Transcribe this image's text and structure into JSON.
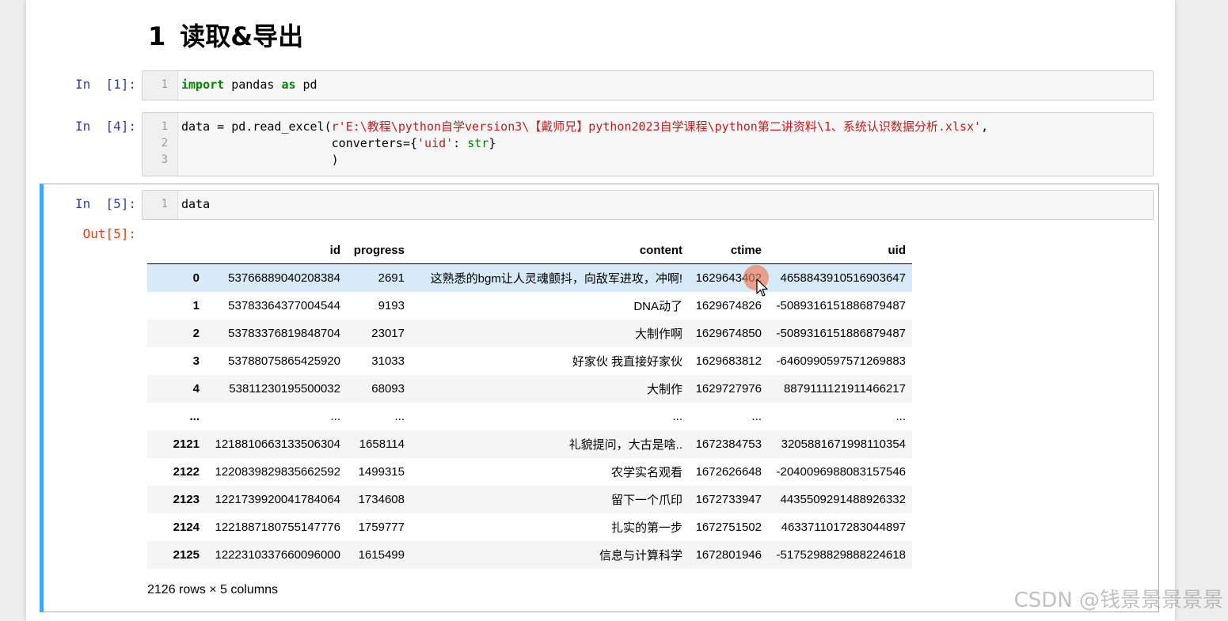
{
  "heading": {
    "number": "1",
    "title": "读取&导出"
  },
  "cells": [
    {
      "prompt": "In  [1]:",
      "lines": [
        {
          "no": "1",
          "kw1": "import",
          "mid": " pandas ",
          "kw2": "as",
          "end": " pd"
        }
      ]
    },
    {
      "prompt": "In  [4]:",
      "lines": [
        {
          "no": "1",
          "pre": "data = pd.read_excel(",
          "str": "r'E:\\教程\\python自学version3\\【戴师兄】python2023自学课程\\python第二讲资料\\1、系统认识数据分析.xlsx'",
          "post": ","
        },
        {
          "no": "2",
          "pre": "                     converters={",
          "str": "'uid'",
          "mid": ": ",
          "builtin": "str",
          "post": "}"
        },
        {
          "no": "3",
          "text": "                     )"
        }
      ]
    },
    {
      "prompt": "In  [5]:",
      "out_prompt": "Out[5]:",
      "lines": [
        {
          "no": "1",
          "text": "data"
        }
      ]
    }
  ],
  "dataframe": {
    "columns": [
      "id",
      "progress",
      "content",
      "ctime",
      "uid"
    ],
    "rows": [
      {
        "index": "0",
        "id": "53766889040208384",
        "progress": "2691",
        "content": "这熟悉的bgm让人灵魂颤抖，向敌军进攻，冲啊!",
        "ctime": "1629643402",
        "uid": "4658843910516903647"
      },
      {
        "index": "1",
        "id": "53783364377004544",
        "progress": "9193",
        "content": "DNA动了",
        "ctime": "1629674826",
        "uid": "-5089316151886879487"
      },
      {
        "index": "2",
        "id": "53783376819848704",
        "progress": "23017",
        "content": "大制作啊",
        "ctime": "1629674850",
        "uid": "-5089316151886879487"
      },
      {
        "index": "3",
        "id": "53788075865425920",
        "progress": "31033",
        "content": "好家伙 我直接好家伙",
        "ctime": "1629683812",
        "uid": "-6460990597571269883"
      },
      {
        "index": "4",
        "id": "53811230195500032",
        "progress": "68093",
        "content": "大制作",
        "ctime": "1629727976",
        "uid": "8879111121911466217"
      },
      {
        "index": "...",
        "id": "...",
        "progress": "...",
        "content": "...",
        "ctime": "...",
        "uid": "..."
      },
      {
        "index": "2121",
        "id": "1218810663133506304",
        "progress": "1658114",
        "content": "礼貌提问，大古是啥..",
        "ctime": "1672384753",
        "uid": "3205881671998110354"
      },
      {
        "index": "2122",
        "id": "1220839829835662592",
        "progress": "1499315",
        "content": "农学实名观看",
        "ctime": "1672626648",
        "uid": "-2040096988083157546"
      },
      {
        "index": "2123",
        "id": "1221739920041784064",
        "progress": "1734608",
        "content": "留下一个爪印",
        "ctime": "1672733947",
        "uid": "4435509291488926332"
      },
      {
        "index": "2124",
        "id": "1221887180755147776",
        "progress": "1759777",
        "content": "扎实的第一步",
        "ctime": "1672751502",
        "uid": "4633711017283044897"
      },
      {
        "index": "2125",
        "id": "1222310337660096000",
        "progress": "1615499",
        "content": "信息与计算科学",
        "ctime": "1672801946",
        "uid": "-5175298829888224618"
      }
    ],
    "shape_text": "2126 rows × 5 columns"
  },
  "watermark": "CSDN @钱景景景景景",
  "colors": {
    "selected_cell_bar": "#42a5f5",
    "in_prompt": "#303f9f",
    "out_prompt": "#d84315",
    "row_hover": "#d6eaf8"
  }
}
